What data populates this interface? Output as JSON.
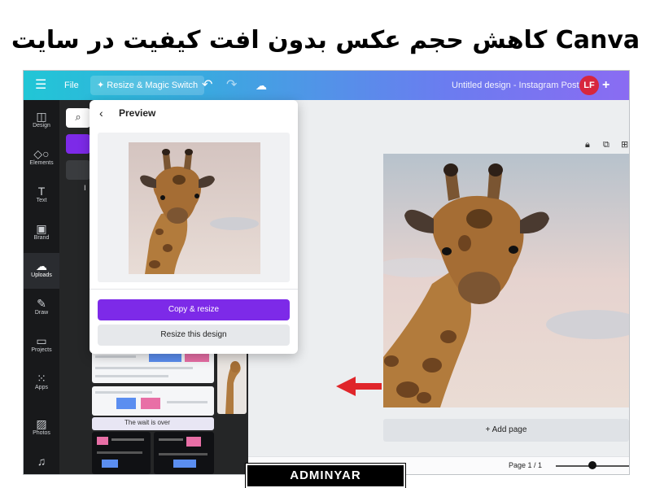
{
  "title": "کاهش حجم عکس بدون افت کیفیت در سایت Canva",
  "topbar": {
    "menu_icon": "menu-icon",
    "file_label": "File",
    "resize_label": "✦ Resize & Magic Switch",
    "doc_title": "Untitled design - Instagram Post",
    "avatar_initials": "LF"
  },
  "rail": {
    "items": [
      {
        "label": "Design",
        "icon": "layout-icon"
      },
      {
        "label": "Elements",
        "icon": "shapes-icon"
      },
      {
        "label": "Text",
        "icon": "text-icon"
      },
      {
        "label": "Brand",
        "icon": "brand-icon"
      },
      {
        "label": "Uploads",
        "icon": "upload-cloud-icon"
      },
      {
        "label": "Draw",
        "icon": "pen-icon"
      },
      {
        "label": "Projects",
        "icon": "folder-icon"
      },
      {
        "label": "Apps",
        "icon": "apps-grid-icon"
      },
      {
        "label": "Photos",
        "icon": "photo-icon"
      }
    ],
    "active": "Uploads"
  },
  "sidepanel": {
    "tab_label": "I",
    "banner_text": "The wait is over"
  },
  "popup": {
    "title": "Preview",
    "primary_button": "Copy & resize",
    "secondary_button": "Resize this design"
  },
  "canvas": {
    "add_page_label": "+ Add page",
    "page_indicator": "Page 1 / 1",
    "zoom_fraction": 0.5
  },
  "watermark": "ADMINYAR",
  "colors": {
    "accent_purple": "#7d2ae8",
    "avatar_red": "#d7263d",
    "arrow_red": "#e0262b"
  }
}
